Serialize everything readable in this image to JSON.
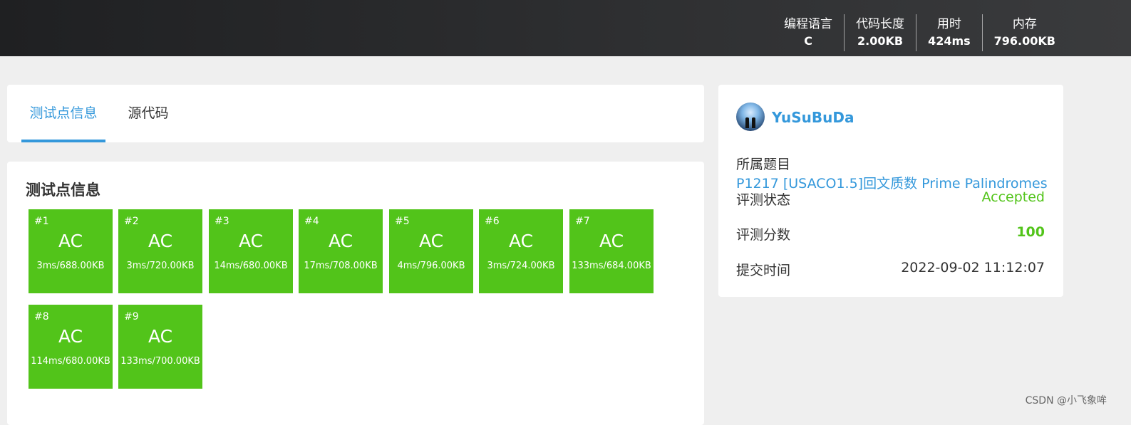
{
  "header": {
    "stats": [
      {
        "label": "编程语言",
        "value": "C"
      },
      {
        "label": "代码长度",
        "value": "2.00KB"
      },
      {
        "label": "用时",
        "value": "424ms"
      },
      {
        "label": "内存",
        "value": "796.00KB"
      }
    ]
  },
  "tabs": [
    {
      "label": "测试点信息",
      "active": true
    },
    {
      "label": "源代码",
      "active": false
    }
  ],
  "cases_section": {
    "title": "测试点信息",
    "cases": [
      {
        "num": "#1",
        "result": "AC",
        "info": "3ms/688.00KB"
      },
      {
        "num": "#2",
        "result": "AC",
        "info": "3ms/720.00KB"
      },
      {
        "num": "#3",
        "result": "AC",
        "info": "14ms/680.00KB"
      },
      {
        "num": "#4",
        "result": "AC",
        "info": "17ms/708.00KB"
      },
      {
        "num": "#5",
        "result": "AC",
        "info": "4ms/796.00KB"
      },
      {
        "num": "#6",
        "result": "AC",
        "info": "3ms/724.00KB"
      },
      {
        "num": "#7",
        "result": "AC",
        "info": "133ms/684.00KB"
      },
      {
        "num": "#8",
        "result": "AC",
        "info": "114ms/680.00KB"
      },
      {
        "num": "#9",
        "result": "AC",
        "info": "133ms/700.00KB"
      }
    ],
    "accent_color": "#52c41a"
  },
  "submission": {
    "avatar_icon": "user-avatar",
    "username": "YuSuBuDa",
    "problem_label": "所属题目",
    "problem_value": "P1217 [USACO1.5]回文质数 Prime Palindromes",
    "status_label": "评测状态",
    "status_value": "Accepted",
    "score_label": "评测分数",
    "score_value": "100",
    "time_label": "提交时间",
    "time_value": "2022-09-02 11:12:07"
  },
  "watermark": "CSDN @小飞象哞",
  "colors": {
    "link": "#3498db",
    "success": "#52c41a",
    "page_bg": "#efefef"
  }
}
